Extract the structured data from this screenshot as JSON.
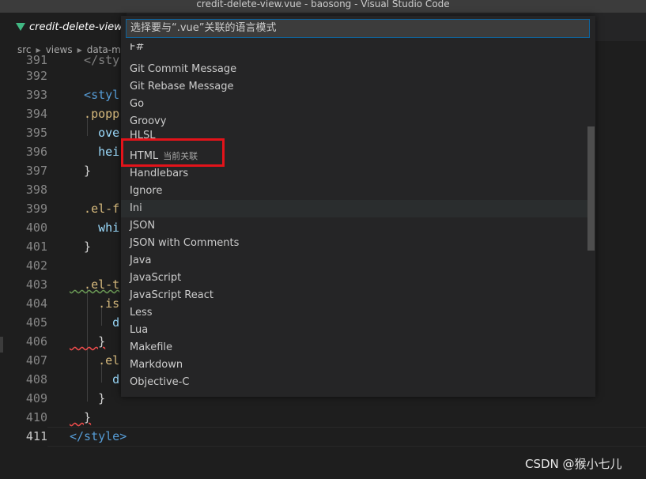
{
  "window": {
    "title": "credit-delete-view.vue - baosong - Visual Studio Code"
  },
  "tab": {
    "label": "credit-delete-view.vue",
    "icon": "vue-file-icon"
  },
  "breadcrumb": [
    "src",
    "views",
    "data-mar"
  ],
  "editor": {
    "lines": [
      {
        "num": "391",
        "code": "  </sty"
      },
      {
        "num": "392",
        "code": ""
      },
      {
        "num": "393",
        "code": "  <styl"
      },
      {
        "num": "394",
        "code": "  .popp"
      },
      {
        "num": "395",
        "code": "    ove"
      },
      {
        "num": "396",
        "code": "    hei"
      },
      {
        "num": "397",
        "code": "  }"
      },
      {
        "num": "398",
        "code": ""
      },
      {
        "num": "399",
        "code": "  .el-f"
      },
      {
        "num": "400",
        "code": "    whi"
      },
      {
        "num": "401",
        "code": "  }"
      },
      {
        "num": "402",
        "code": ""
      },
      {
        "num": "403",
        "code": "  .el-t"
      },
      {
        "num": "404",
        "code": "    .is"
      },
      {
        "num": "405",
        "code": "      d"
      },
      {
        "num": "406",
        "code": "    }"
      },
      {
        "num": "407",
        "code": "    .el"
      },
      {
        "num": "408",
        "code": "      d"
      },
      {
        "num": "409",
        "code": "    }"
      },
      {
        "num": "410",
        "code": "  }"
      },
      {
        "num": "411",
        "code": "</style>"
      }
    ]
  },
  "quickpick": {
    "placeholder": "选择要与“.vue”关联的语言模式",
    "items": [
      {
        "label": "F#",
        "desc": ""
      },
      {
        "label": "Git Commit Message",
        "desc": ""
      },
      {
        "label": "Git Rebase Message",
        "desc": ""
      },
      {
        "label": "Go",
        "desc": ""
      },
      {
        "label": "Groovy",
        "desc": ""
      },
      {
        "label": "HLSL",
        "desc": ""
      },
      {
        "label": "HTML",
        "desc": "当前关联"
      },
      {
        "label": "Handlebars",
        "desc": ""
      },
      {
        "label": "Ignore",
        "desc": ""
      },
      {
        "label": "Ini",
        "desc": ""
      },
      {
        "label": "JSON",
        "desc": ""
      },
      {
        "label": "JSON with Comments",
        "desc": ""
      },
      {
        "label": "Java",
        "desc": ""
      },
      {
        "label": "JavaScript",
        "desc": ""
      },
      {
        "label": "JavaScript React",
        "desc": ""
      },
      {
        "label": "Less",
        "desc": ""
      },
      {
        "label": "Lua",
        "desc": ""
      },
      {
        "label": "Makefile",
        "desc": ""
      },
      {
        "label": "Markdown",
        "desc": ""
      },
      {
        "label": "Objective-C",
        "desc": ""
      }
    ]
  },
  "watermark": "CSDN @猴小七儿",
  "colors": {
    "highlight": "#e3131a",
    "accent": "#0e639c",
    "vue_green": "#41b883"
  }
}
